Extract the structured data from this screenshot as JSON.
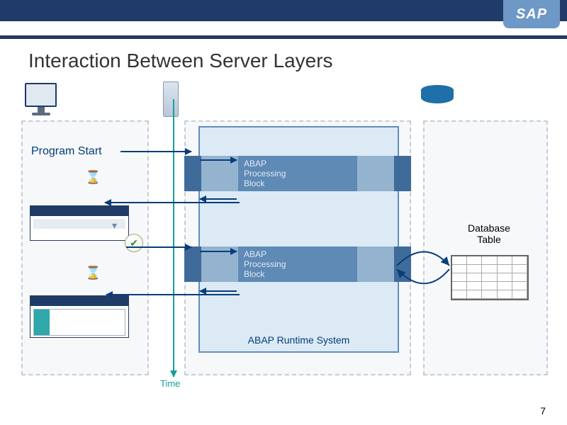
{
  "logo": "SAP",
  "title": "Interaction Between Server Layers",
  "page_number": "7",
  "time_axis_label": "Time",
  "client": {
    "program_start_label": "Program Start"
  },
  "server": {
    "runtime_caption": "ABAP Runtime System",
    "block_label_line1": "ABAP",
    "block_label_line2": "Processing",
    "block_label_line3": "Block"
  },
  "database": {
    "label_line1": "Database",
    "label_line2": "Table"
  }
}
